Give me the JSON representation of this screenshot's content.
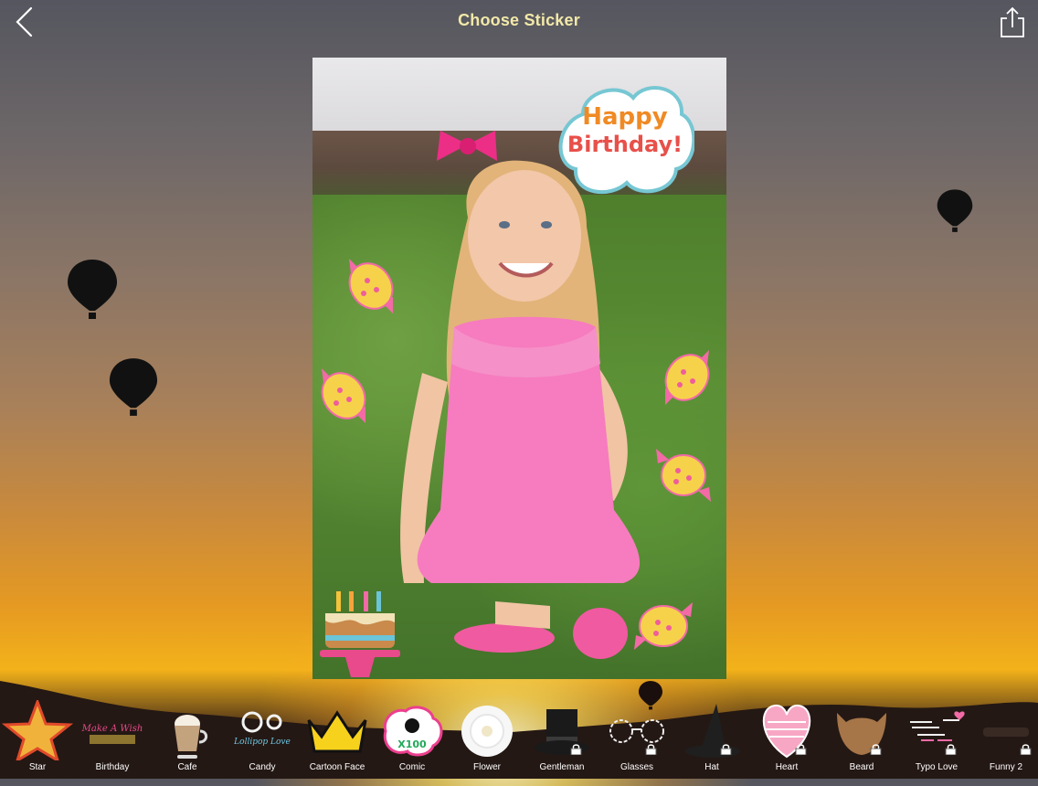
{
  "header": {
    "title": "Choose Sticker",
    "back_icon": "chevron-left-icon",
    "share_icon": "share-icon"
  },
  "photo": {
    "stickers": {
      "birthday_cloud": {
        "line1": "Happy",
        "line2": "Birthday!"
      }
    }
  },
  "categories": [
    {
      "label": "Star",
      "icon": "star-icon",
      "locked": false
    },
    {
      "label": "Birthday",
      "icon": "make-a-wish-icon",
      "thumb_text": "Make A Wish",
      "locked": false
    },
    {
      "label": "Cafe",
      "icon": "coffee-cup-icon",
      "locked": false
    },
    {
      "label": "Candy",
      "icon": "lollipop-icon",
      "thumb_text": "Lollipop Love",
      "locked": false
    },
    {
      "label": "Cartoon Face",
      "icon": "crown-icon",
      "locked": false
    },
    {
      "label": "Comic",
      "icon": "skull-icon",
      "thumb_text": "X100",
      "locked": false
    },
    {
      "label": "Flower",
      "icon": "flower-icon",
      "locked": false
    },
    {
      "label": "Gentleman",
      "icon": "top-hat-icon",
      "locked": true
    },
    {
      "label": "Glasses",
      "icon": "glasses-icon",
      "locked": true
    },
    {
      "label": "Hat",
      "icon": "witch-hat-icon",
      "locked": true
    },
    {
      "label": "Heart",
      "icon": "heart-icon",
      "locked": true
    },
    {
      "label": "Beard",
      "icon": "beard-icon",
      "locked": true
    },
    {
      "label": "Typo Love",
      "icon": "typo-love-icon",
      "locked": true
    },
    {
      "label": "Funny 2",
      "icon": "funny-icon",
      "locked": true
    }
  ],
  "colors": {
    "title": "#f2e9a8",
    "accent_pink": "#f04f9c",
    "candy_yellow": "#f6d24b"
  }
}
